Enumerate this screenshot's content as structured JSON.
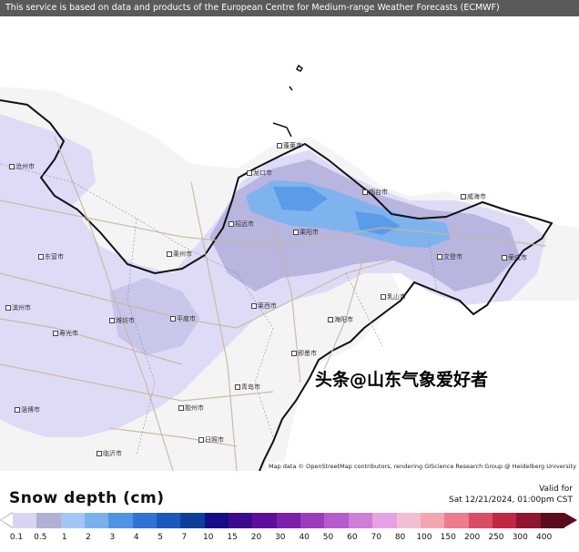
{
  "banner": {
    "text": "This service is based on data and products of the European Centre for Medium-range Weather Forecasts (ECMWF)"
  },
  "map": {
    "credit": "Map data © OpenStreetMap contributors, rendering GIScience Research Group @ Heidelberg University",
    "watermark": "头条@山东气象爱好者",
    "cities": [
      {
        "name": "蓬莱市"
      },
      {
        "name": "龙口市"
      },
      {
        "name": "烟台市"
      },
      {
        "name": "威海市"
      },
      {
        "name": "招远市"
      },
      {
        "name": "莱阳市"
      },
      {
        "name": "文登市"
      },
      {
        "name": "乳山市"
      },
      {
        "name": "莱州市"
      },
      {
        "name": "海阳市"
      },
      {
        "name": "平度市"
      },
      {
        "name": "即墨市"
      },
      {
        "name": "莱西市"
      },
      {
        "name": "青岛市"
      },
      {
        "name": "荣成市"
      },
      {
        "name": "胶州市"
      },
      {
        "name": "潍坊市"
      },
      {
        "name": "寿光市"
      },
      {
        "name": "东营市"
      },
      {
        "name": "日照市"
      },
      {
        "name": "临沂市"
      },
      {
        "name": "沧州市"
      },
      {
        "name": "滨州市"
      },
      {
        "name": "淄博市"
      }
    ]
  },
  "legend": {
    "title": "Snow depth (cm)",
    "valid_label": "Valid for",
    "valid_time": "Sat 12/21/2024, 01:00pm CST",
    "ticks": [
      "0.1",
      "0.5",
      "1",
      "2",
      "3",
      "4",
      "5",
      "7",
      "10",
      "15",
      "20",
      "30",
      "40",
      "50",
      "60",
      "70",
      "80",
      "100",
      "150",
      "200",
      "250",
      "300",
      "400"
    ],
    "colors": [
      "#d9d4f2",
      "#b0b0d6",
      "#a4c6f2",
      "#7ab1ec",
      "#4f94e4",
      "#2f73d8",
      "#1c58bd",
      "#0d3f98",
      "#140d87",
      "#3b0a8f",
      "#5b0f9a",
      "#7b22ac",
      "#9b3cbc",
      "#b55bcc",
      "#ce7dd8",
      "#e6a3e4",
      "#f1bfd1",
      "#f3a6b2",
      "#eb7b8d",
      "#d94d66",
      "#bf2742",
      "#8e1630",
      "#5a0b1d"
    ]
  }
}
